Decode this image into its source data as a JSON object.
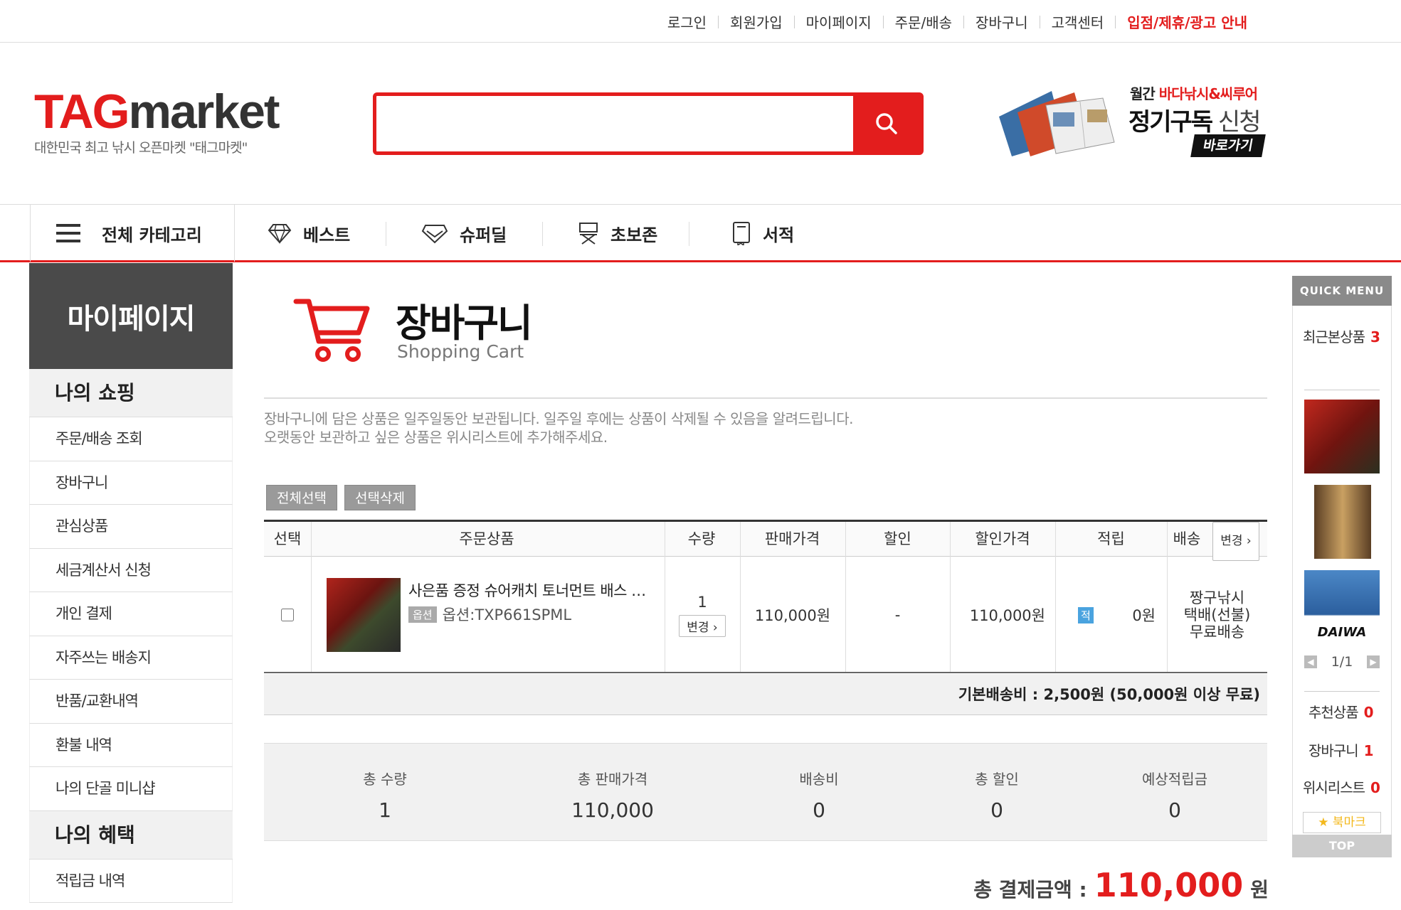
{
  "top_links": {
    "login": "로그인",
    "signup": "회원가입",
    "mypage": "마이페이지",
    "order": "주문/배송",
    "cart": "장바구니",
    "support": "고객센터",
    "partner": "입점/제휴/광고 안내"
  },
  "logo": {
    "tag": "TAG",
    "market": "market",
    "subtitle": "대한민국 최고 낚시 오픈마켓 \"태그마켓\""
  },
  "search": {
    "placeholder": "",
    "value": "",
    "icon": "search-icon"
  },
  "promo": {
    "line1_prefix": "월간 ",
    "line1_red": "바다낚시&씨루어",
    "line2_bold": "정기구독",
    "line2_light": " 신청",
    "button": "바로가기"
  },
  "nav": {
    "all_categories": "전체 카테고리",
    "best": "베스트",
    "superdeal": "슈퍼딜",
    "beginner": "초보존",
    "books": "서적"
  },
  "sidebar": {
    "title": "마이페이지",
    "section1": "나의 쇼핑",
    "items": [
      "주문/배송 조회",
      "장바구니",
      "관심상품",
      "세금계산서 신청",
      "개인 결제",
      "자주쓰는 배송지",
      "반품/교환내역",
      "환불 내역",
      "나의 단골 미니샵"
    ],
    "section2": "나의 혜택",
    "items2": [
      "적립금 내역"
    ]
  },
  "page": {
    "title": "장바구니",
    "subtitle": "Shopping Cart",
    "notice1": "장바구니에 담은 상품은 일주일동안 보관됩니다. 일주일 후에는 상품이 삭제될 수 있음을 알려드립니다.",
    "notice2": "오랫동안 보관하고 싶은 상품은 위시리스트에 추가해주세요."
  },
  "buttons": {
    "select_all": "전체선택",
    "delete_selected": "선택삭제"
  },
  "table": {
    "headers": {
      "select": "선택",
      "product": "주문상품",
      "qty": "수량",
      "price": "판매가격",
      "discount": "할인",
      "disc_price": "할인가격",
      "points": "적립",
      "shipping": "배송",
      "change": "변경 ›"
    },
    "rows": [
      {
        "checked": false,
        "name": "사은품 증정 슈어캐치 토너먼트 배스 …",
        "option_tag": "옵션",
        "option": "옵션:TXP661SPML",
        "qty": "1",
        "qty_change": "변경 ›",
        "price": "110,000원",
        "discount": "-",
        "disc_price": "110,000원",
        "points_tag": "적",
        "points": "0원",
        "ship1": "짱구낚시",
        "ship2": "택배(선불)",
        "ship3": "무료배송"
      }
    ]
  },
  "shipping_note": "기본배송비 : 2,500원 (50,000원 이상 무료)",
  "summary": {
    "qty_label": "총 수량",
    "qty": "1",
    "price_label": "총 판매가격",
    "price": "110,000",
    "ship_label": "배송비",
    "ship": "0",
    "disc_label": "총 할인",
    "disc": "0",
    "points_label": "예상적립금",
    "points": "0"
  },
  "total": {
    "label": "총 결제금액 :",
    "amount": "110,000",
    "unit": "원"
  },
  "quick_menu": {
    "title": "QUICK MENU",
    "recent_label": "최근본상품",
    "recent_count": "3",
    "brand": "DAIWA",
    "page": "1/1",
    "recommend_label": "추천상품",
    "recommend_count": "0",
    "cart_label": "장바구니",
    "cart_count": "1",
    "wish_label": "위시리스트",
    "wish_count": "0",
    "bookmark": "북마크",
    "top": "TOP"
  },
  "colors": {
    "accent": "#e31d1d",
    "sidebar_head": "#4a4a4a"
  }
}
